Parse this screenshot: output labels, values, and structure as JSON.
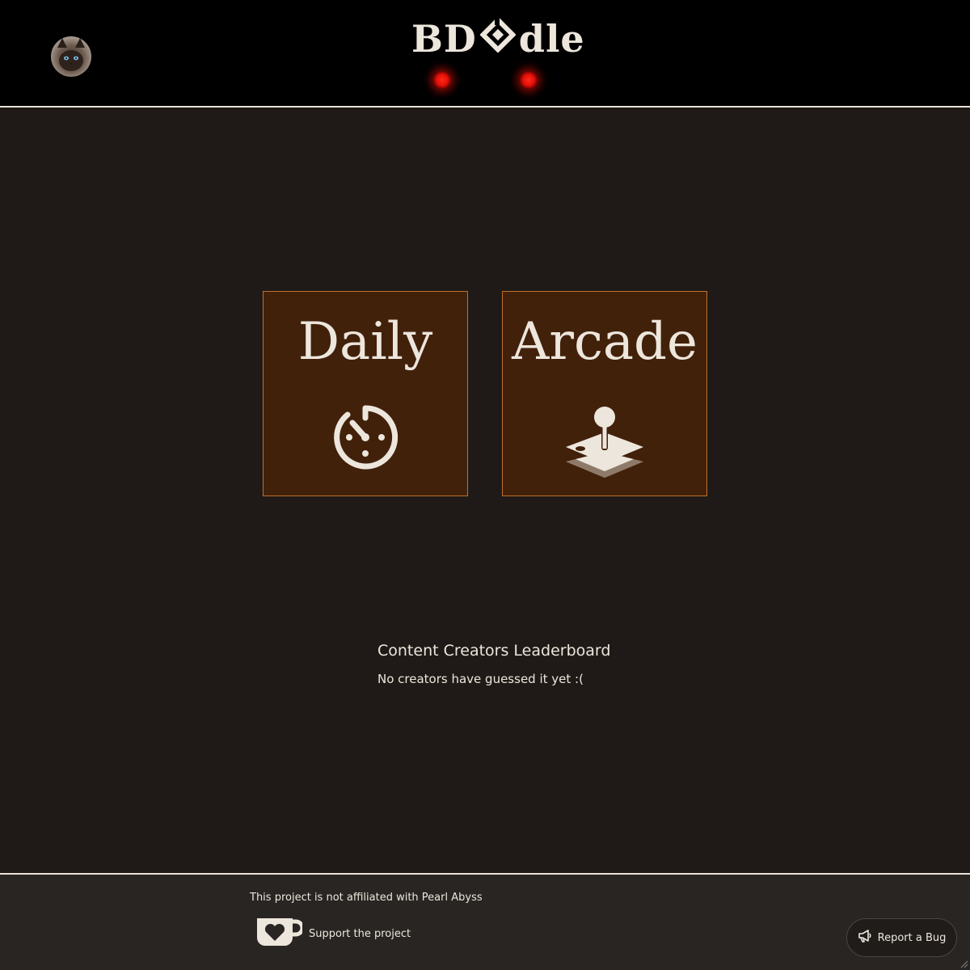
{
  "header": {
    "logo_prefix": "BD",
    "logo_suffix": "dle",
    "avatar": "cat-avatar-icon",
    "indicator_color": "#e40f08"
  },
  "modes": [
    {
      "label": "Daily",
      "icon": "daily-timer-icon"
    },
    {
      "label": "Arcade",
      "icon": "joystick-icon"
    }
  ],
  "leaderboard": {
    "title": "Content Creators Leaderboard",
    "empty_message": "No creators have guessed it yet :("
  },
  "footer": {
    "disclaimer": "This project is not affiliated with Pearl Abyss",
    "support_label": "Support the project",
    "support_icon": "coffee-cup-heart-icon",
    "report_label": "Report a Bug",
    "report_icon": "megaphone-icon"
  },
  "colors": {
    "background": "#1f1a17",
    "card_fill": "#42210b",
    "card_border": "#c0702a",
    "text": "#ede6dc",
    "header_bg": "#000000",
    "footer_bg": "#282523"
  }
}
